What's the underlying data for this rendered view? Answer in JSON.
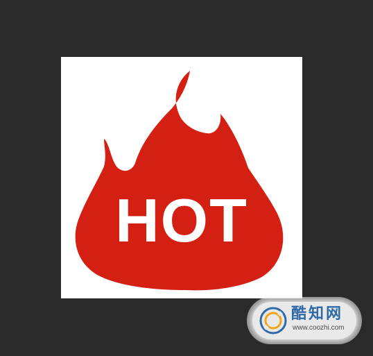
{
  "image": {
    "hot_label": "HOT",
    "icon": "flame-icon",
    "flame_color": "#d42012",
    "background_color": "#ffffff"
  },
  "canvas": {
    "background_color": "#2a2a2a"
  },
  "watermark": {
    "brand": "酷知网",
    "url": "www.coozhi.com",
    "logo_icon": "coozhi-logo-icon",
    "brand_color": "#2f6aa8"
  }
}
